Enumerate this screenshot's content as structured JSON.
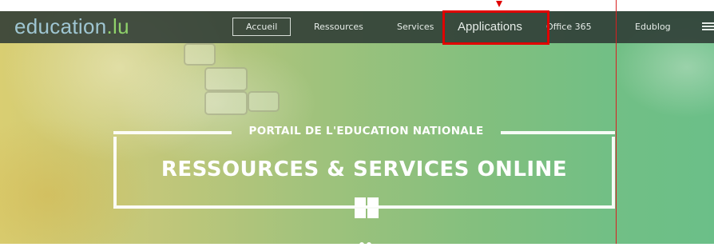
{
  "logo": {
    "name": "education",
    "tld": ".lu"
  },
  "nav": {
    "items": [
      {
        "label": "Accueil",
        "active": true
      },
      {
        "label": "Ressources"
      },
      {
        "label": "Services"
      },
      {
        "label": "Applications",
        "highlighted": true
      },
      {
        "label": "Office 365"
      },
      {
        "label": "Edublog"
      }
    ]
  },
  "hero": {
    "subtitle": "PORTAIL DE L'EDUCATION NATIONALE",
    "headline": "RESSOURCES & SERVICES ONLINE"
  },
  "icons": {
    "menu": "hamburger-menu-icon",
    "windows": "windows-icon",
    "highlight_arrow": "down-arrow-icon"
  },
  "colors": {
    "highlight": "#e00000",
    "logo": "#9fc6d2",
    "logo_tld": "#8fd26a",
    "navbar": "#2d3a34"
  }
}
